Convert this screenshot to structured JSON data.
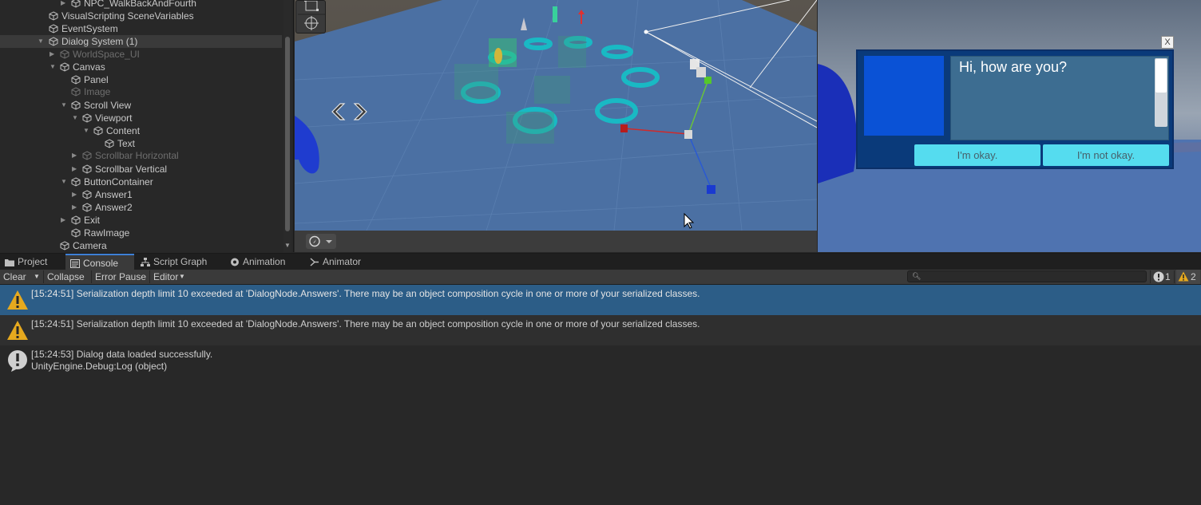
{
  "hierarchy": {
    "items": [
      {
        "label": "NPC_WalkBackAndFourth",
        "arrow": "collapsed",
        "dim": false
      },
      {
        "label": "VisualScripting SceneVariables",
        "arrow": "none",
        "dim": false
      },
      {
        "label": "EventSystem",
        "arrow": "none",
        "dim": false
      },
      {
        "label": "Dialog System (1)",
        "arrow": "expanded",
        "dim": false,
        "selected": true
      },
      {
        "label": "WorldSpace_UI",
        "arrow": "collapsed",
        "dim": true
      },
      {
        "label": "Canvas",
        "arrow": "expanded",
        "dim": false
      },
      {
        "label": "Panel",
        "arrow": "none",
        "dim": false
      },
      {
        "label": "Image",
        "arrow": "none",
        "dim": true
      },
      {
        "label": "Scroll View",
        "arrow": "expanded",
        "dim": false
      },
      {
        "label": "Viewport",
        "arrow": "expanded",
        "dim": false
      },
      {
        "label": "Content",
        "arrow": "expanded",
        "dim": false
      },
      {
        "label": "Text",
        "arrow": "none",
        "dim": false
      },
      {
        "label": "Scrollbar Horizontal",
        "arrow": "collapsed",
        "dim": true
      },
      {
        "label": "Scrollbar Vertical",
        "arrow": "collapsed",
        "dim": false
      },
      {
        "label": "ButtonContainer",
        "arrow": "expanded",
        "dim": false
      },
      {
        "label": "Answer1",
        "arrow": "collapsed",
        "dim": false
      },
      {
        "label": "Answer2",
        "arrow": "collapsed",
        "dim": false
      },
      {
        "label": "Exit",
        "arrow": "collapsed",
        "dim": false
      },
      {
        "label": "RawImage",
        "arrow": "none",
        "dim": false
      },
      {
        "label": "Camera",
        "arrow": "none",
        "dim": false
      }
    ]
  },
  "game": {
    "dialog_text": "Hi, how are you?",
    "answer1": "I'm okay.",
    "answer2": "I'm not okay.",
    "exit_label": "X",
    "portrait_color": "#0a52d6",
    "panel_color": "#0a3a7a",
    "button_color": "#55dcef"
  },
  "tabs": [
    {
      "label": "Project",
      "icon": "folder-icon",
      "active": false
    },
    {
      "label": "Console",
      "icon": "console-icon",
      "active": true
    },
    {
      "label": "Script Graph",
      "icon": "graph-icon",
      "active": false
    },
    {
      "label": "Animation",
      "icon": "animation-icon",
      "active": false
    },
    {
      "label": "Animator",
      "icon": "animator-icon",
      "active": false
    }
  ],
  "console_toolbar": {
    "clear": "Clear",
    "collapse": "Collapse",
    "error_pause": "Error Pause",
    "editor": "Editor",
    "info_count": "1",
    "warning_count": "2"
  },
  "console": {
    "entries": [
      {
        "type": "warning",
        "line1": "[15:24:51] Serialization depth limit 10 exceeded at 'DialogNode.Answers'. There may be an object composition cycle in one or more of your serialized classes.",
        "line2": "",
        "selected": true
      },
      {
        "type": "warning",
        "line1": "[15:24:51] Serialization depth limit 10 exceeded at 'DialogNode.Answers'. There may be an object composition cycle in one or more of your serialized classes.",
        "line2": "",
        "selected": false
      },
      {
        "type": "info",
        "line1": "[15:24:53] Dialog data loaded successfully.",
        "line2": "UnityEngine.Debug:Log (object)",
        "selected": false
      }
    ]
  },
  "colors": {
    "selection": "#2c5d87",
    "tab_accent": "#3d7fd6",
    "warning": "#e6a91e"
  }
}
